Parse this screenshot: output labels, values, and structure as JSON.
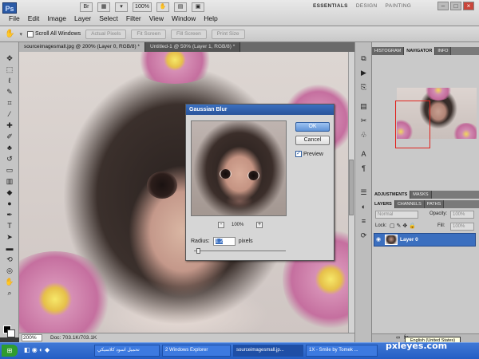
{
  "app": {
    "logo": "Ps"
  },
  "menu": [
    "File",
    "Edit",
    "Image",
    "Layer",
    "Select",
    "Filter",
    "View",
    "Window",
    "Help"
  ],
  "topbar": {
    "zoom": "100%"
  },
  "workspace": [
    "ESSENTIALS",
    "DESIGN",
    "PAINTING"
  ],
  "window_controls": [
    "–",
    "□",
    "×"
  ],
  "options_bar": {
    "scroll_all": "Scroll All Windows",
    "buttons": [
      "Actual Pixels",
      "Fit Screen",
      "Fill Screen",
      "Print Size"
    ]
  },
  "tabs": [
    "sourceimagesmall.jpg @ 200% (Layer 0, RGB/8) *",
    "Untitled-1 @ 50% (Layer 1, RGB/8) *"
  ],
  "status": {
    "zoom": "200%",
    "doc": "Doc: 703.1K/703.1K"
  },
  "panels": {
    "top_tabs": [
      "HISTOGRAM",
      "NAVIGATOR",
      "INFO"
    ],
    "mid_tabs": [
      "ADJUSTMENTS",
      "MASKS"
    ],
    "layer_tabs": [
      "LAYERS",
      "CHANNELS",
      "PATHS"
    ],
    "blend": "Normal",
    "opacity_label": "Opacity:",
    "opacity_value": "100%",
    "lock_label": "Lock:",
    "fill_label": "Fill:",
    "fill_value": "100%",
    "layer_name": "Layer 0"
  },
  "language_tip": "English (United States)",
  "dialog": {
    "title": "Gaussian Blur",
    "ok": "OK",
    "cancel": "Cancel",
    "preview_label": "Preview",
    "preview_checked": true,
    "zoom": "100%",
    "zoom_minus": "-",
    "zoom_plus": "+",
    "radius_label": "Radius:",
    "radius_value": "1.2",
    "radius_unit": "pixels"
  },
  "taskbar": {
    "start": "⊞",
    "items": [
      {
        "label": "تحميل اسود كلاسيكي",
        "active": false
      },
      {
        "label": "2 Windows Explorer",
        "active": false
      },
      {
        "label": "sourceimagesmall.jp...",
        "active": true
      },
      {
        "label": "1X - Smile by Tomek ...",
        "active": false
      }
    ]
  },
  "watermark": "pxleyes.com"
}
